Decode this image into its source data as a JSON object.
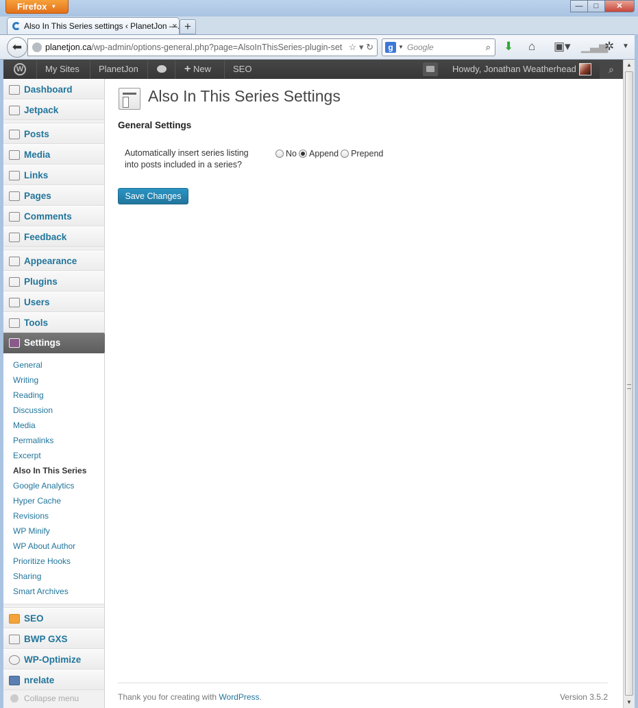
{
  "browser": {
    "app_button": "Firefox",
    "window_controls": {
      "minimize": "—",
      "maximize": "□",
      "close": "✕"
    },
    "tab": {
      "title": "Also In This Series settings ‹ PlanetJon —...",
      "close": "×"
    },
    "new_tab": "+",
    "url": {
      "host": "planetjon.ca",
      "path": "/wp-admin/options-general.php?page=AlsoInThisSeries-plugin-set"
    },
    "search": {
      "engine": "g",
      "placeholder": "Google"
    }
  },
  "adminbar": {
    "my_sites": "My Sites",
    "site_name": "PlanetJon",
    "new": "New",
    "new_prefix": "+",
    "seo": "SEO",
    "howdy": "Howdy, Jonathan Weatherhead"
  },
  "sidebar": {
    "group1": [
      {
        "label": "Dashboard",
        "icon": "dashboard-icon"
      },
      {
        "label": "Jetpack",
        "icon": "jetpack-icon"
      }
    ],
    "group2": [
      {
        "label": "Posts",
        "icon": "pin-icon"
      },
      {
        "label": "Media",
        "icon": "media-icon"
      },
      {
        "label": "Links",
        "icon": "link-icon"
      },
      {
        "label": "Pages",
        "icon": "pages-icon"
      },
      {
        "label": "Comments",
        "icon": "comment-icon"
      },
      {
        "label": "Feedback",
        "icon": "feedback-icon"
      }
    ],
    "group3": [
      {
        "label": "Appearance",
        "icon": "appearance-icon"
      },
      {
        "label": "Plugins",
        "icon": "plugin-icon"
      },
      {
        "label": "Users",
        "icon": "users-icon"
      },
      {
        "label": "Tools",
        "icon": "tools-icon"
      }
    ],
    "settings": {
      "label": "Settings",
      "icon": "settings-icon"
    },
    "settings_submenu": [
      "General",
      "Writing",
      "Reading",
      "Discussion",
      "Media",
      "Permalinks",
      "Excerpt",
      "Also In This Series",
      "Google Analytics",
      "Hyper Cache",
      "Revisions",
      "WP Minify",
      "WP About Author",
      "Prioritize Hooks",
      "Sharing",
      "Smart Archives"
    ],
    "current_submenu": "Also In This Series",
    "group4": [
      {
        "label": "SEO",
        "icon": "seo-icon"
      },
      {
        "label": "BWP GXS",
        "icon": "sitemap-icon"
      },
      {
        "label": "WP-Optimize",
        "icon": "gear-icon"
      },
      {
        "label": "nrelate",
        "icon": "nrelate-icon"
      }
    ],
    "collapse": "Collapse menu"
  },
  "main": {
    "title": "Also In This Series Settings",
    "section": "General Settings",
    "field_label": "Automatically insert series listing into posts included in a series?",
    "options": [
      "No",
      "Append",
      "Prepend"
    ],
    "selected_option": "Append",
    "save_label": "Save Changes"
  },
  "footer": {
    "thanks": "Thank you for creating with ",
    "link": "WordPress",
    "period": ".",
    "version": "Version 3.5.2"
  },
  "colors": {
    "link": "#21759b",
    "adminbar": "#464646",
    "active_menu": "#6b6b6b",
    "primary_button": "#21759b"
  }
}
